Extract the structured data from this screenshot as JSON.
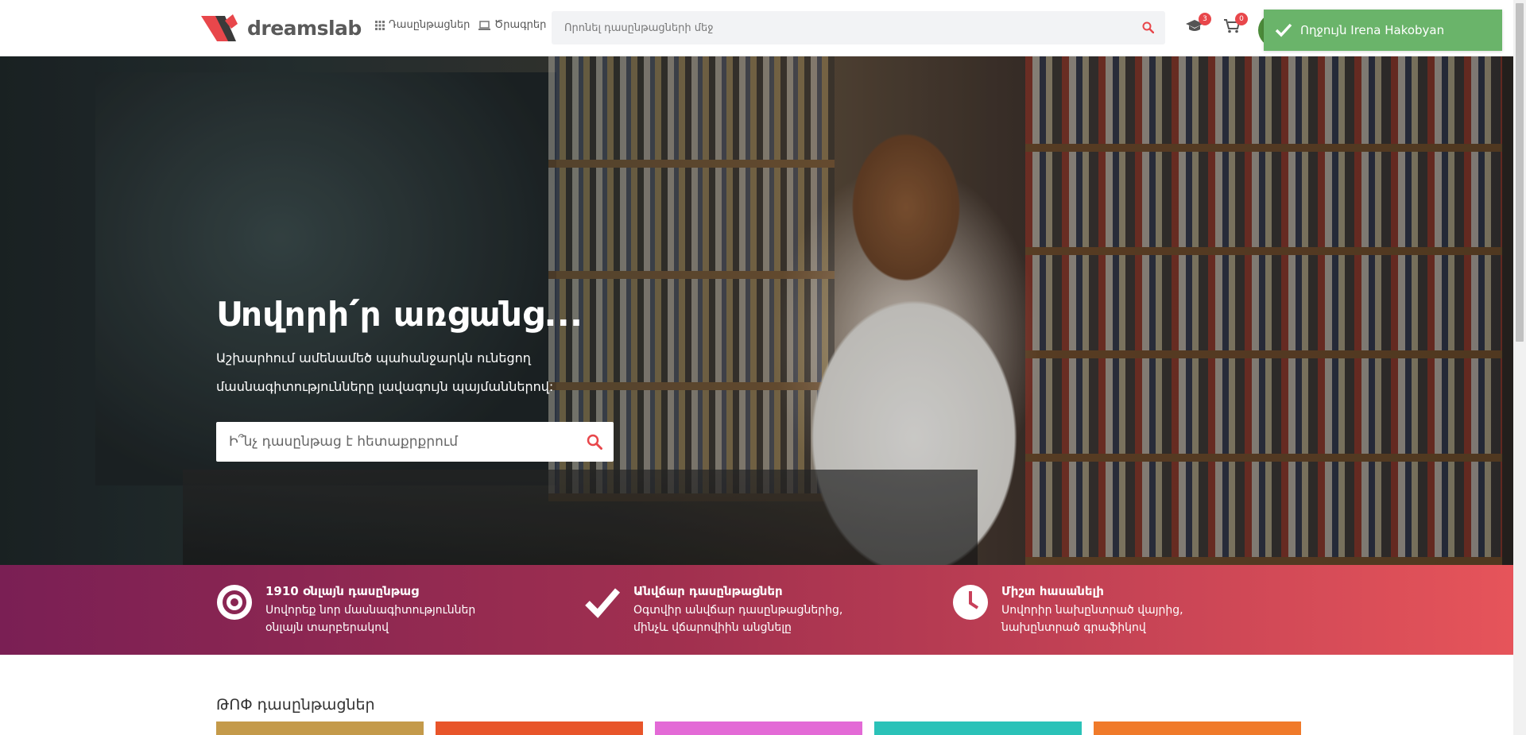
{
  "header": {
    "logo_text": "dreamslab",
    "nav": {
      "courses": "Դասընթացներ",
      "programs": "Ծրագրեր"
    },
    "search_placeholder": "Որոնել դասընթացների մեջ",
    "my_courses_count": "3",
    "cart_count": "0"
  },
  "toast": {
    "message": "Ողջույն Irena Hakobyan",
    "color": "#6ab46a"
  },
  "hero": {
    "title": "Սովորի՛ր առցանց...",
    "subtitle": "Աշխարհում ամենամեծ պահանջարկն ունեցող մասնագիտությունները լավագույն պայմաններով:",
    "search_placeholder": "Ի՞նչ դասընթաց է հետաքրքրում"
  },
  "features": [
    {
      "icon": "target-icon",
      "title": "1910 օնլայն դասընթաց",
      "desc": "Սովորեք նոր մասնագիտություններ օնլայն տարբերակով"
    },
    {
      "icon": "checkmark-icon",
      "title": "Անվճար դասընթացներ",
      "desc": "Օգտվիր անվճար դասընթացներից, մինչև վճարովիին անցնելը"
    },
    {
      "icon": "clock-icon",
      "title": "Միշտ հասանելի",
      "desc": "Սովորիր նախընտրած վայրից, նախընտրած գրաֆիկով"
    }
  ],
  "top_courses": {
    "title": "ԹՈՓ դասընթացներ",
    "cards": [
      {
        "color": "#c49a4a"
      },
      {
        "color": "#e8552a"
      },
      {
        "color": "#e36ad6"
      },
      {
        "color": "#2bc2b8"
      },
      {
        "color": "#f07a2a"
      }
    ]
  },
  "colors": {
    "brand_red": "#e8474b",
    "band_start": "#7a1f54",
    "band_end": "#e6545a"
  }
}
